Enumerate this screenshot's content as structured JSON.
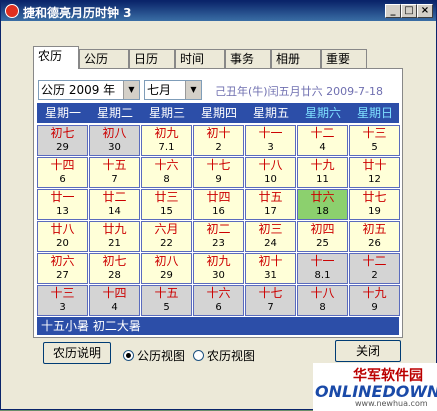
{
  "window": {
    "title": "捷和德亮月历时钟 3"
  },
  "tabs": [
    "农历",
    "公历",
    "日历",
    "时间",
    "事务",
    "相册",
    "重要"
  ],
  "selectors": {
    "year": "公历 2009 年",
    "month": "七月"
  },
  "lunar_info": "己丑年(牛)闰五月廿六 2009-7-18",
  "weekdays": [
    "星期一",
    "星期二",
    "星期三",
    "星期四",
    "星期五",
    "星期六",
    "星期日"
  ],
  "weeks": [
    [
      {
        "l": "初七",
        "s": "29",
        "t": "other"
      },
      {
        "l": "初八",
        "s": "30",
        "t": "other"
      },
      {
        "l": "初九",
        "s": "7.1",
        "t": ""
      },
      {
        "l": "初十",
        "s": "2",
        "t": ""
      },
      {
        "l": "十一",
        "s": "3",
        "t": ""
      },
      {
        "l": "十二",
        "s": "4",
        "t": ""
      },
      {
        "l": "十三",
        "s": "5",
        "t": ""
      }
    ],
    [
      {
        "l": "十四",
        "s": "6",
        "t": ""
      },
      {
        "l": "十五",
        "s": "7",
        "t": ""
      },
      {
        "l": "十六",
        "s": "8",
        "t": ""
      },
      {
        "l": "十七",
        "s": "9",
        "t": ""
      },
      {
        "l": "十八",
        "s": "10",
        "t": ""
      },
      {
        "l": "十九",
        "s": "11",
        "t": ""
      },
      {
        "l": "廿十",
        "s": "12",
        "t": ""
      }
    ],
    [
      {
        "l": "廿一",
        "s": "13",
        "t": ""
      },
      {
        "l": "廿二",
        "s": "14",
        "t": ""
      },
      {
        "l": "廿三",
        "s": "15",
        "t": ""
      },
      {
        "l": "廿四",
        "s": "16",
        "t": ""
      },
      {
        "l": "廿五",
        "s": "17",
        "t": ""
      },
      {
        "l": "廿六",
        "s": "18",
        "t": "today"
      },
      {
        "l": "廿七",
        "s": "19",
        "t": ""
      }
    ],
    [
      {
        "l": "廿八",
        "s": "20",
        "t": ""
      },
      {
        "l": "廿九",
        "s": "21",
        "t": ""
      },
      {
        "l": "六月",
        "s": "22",
        "t": ""
      },
      {
        "l": "初二",
        "s": "23",
        "t": ""
      },
      {
        "l": "初三",
        "s": "24",
        "t": ""
      },
      {
        "l": "初四",
        "s": "25",
        "t": ""
      },
      {
        "l": "初五",
        "s": "26",
        "t": ""
      }
    ],
    [
      {
        "l": "初六",
        "s": "27",
        "t": ""
      },
      {
        "l": "初七",
        "s": "28",
        "t": ""
      },
      {
        "l": "初八",
        "s": "29",
        "t": ""
      },
      {
        "l": "初九",
        "s": "30",
        "t": ""
      },
      {
        "l": "初十",
        "s": "31",
        "t": ""
      },
      {
        "l": "十一",
        "s": "8.1",
        "t": "other"
      },
      {
        "l": "十二",
        "s": "2",
        "t": "other"
      }
    ],
    [
      {
        "l": "十三",
        "s": "3",
        "t": "other"
      },
      {
        "l": "十四",
        "s": "4",
        "t": "other"
      },
      {
        "l": "十五",
        "s": "5",
        "t": "other"
      },
      {
        "l": "十六",
        "s": "6",
        "t": "other"
      },
      {
        "l": "十七",
        "s": "7",
        "t": "other"
      },
      {
        "l": "十八",
        "s": "8",
        "t": "other"
      },
      {
        "l": "十九",
        "s": "9",
        "t": "other"
      }
    ]
  ],
  "solar_terms": "十五小暑  初二大暑",
  "buttons": {
    "lunar_help": "农历说明",
    "ok": "关闭"
  },
  "view_options": [
    {
      "label": "公历视图",
      "selected": true
    },
    {
      "label": "农历视图",
      "selected": false
    }
  ],
  "watermark": {
    "cn": "华军软件园",
    "en": "ONLINEDOWN",
    "url": "www.newhua.com"
  },
  "colors": {
    "accent": "#2c4ea8",
    "lunar_text": "#cc0000",
    "today": "#8cd06e",
    "other_month": "#d4d4d4",
    "in_month": "#ffffd8"
  }
}
